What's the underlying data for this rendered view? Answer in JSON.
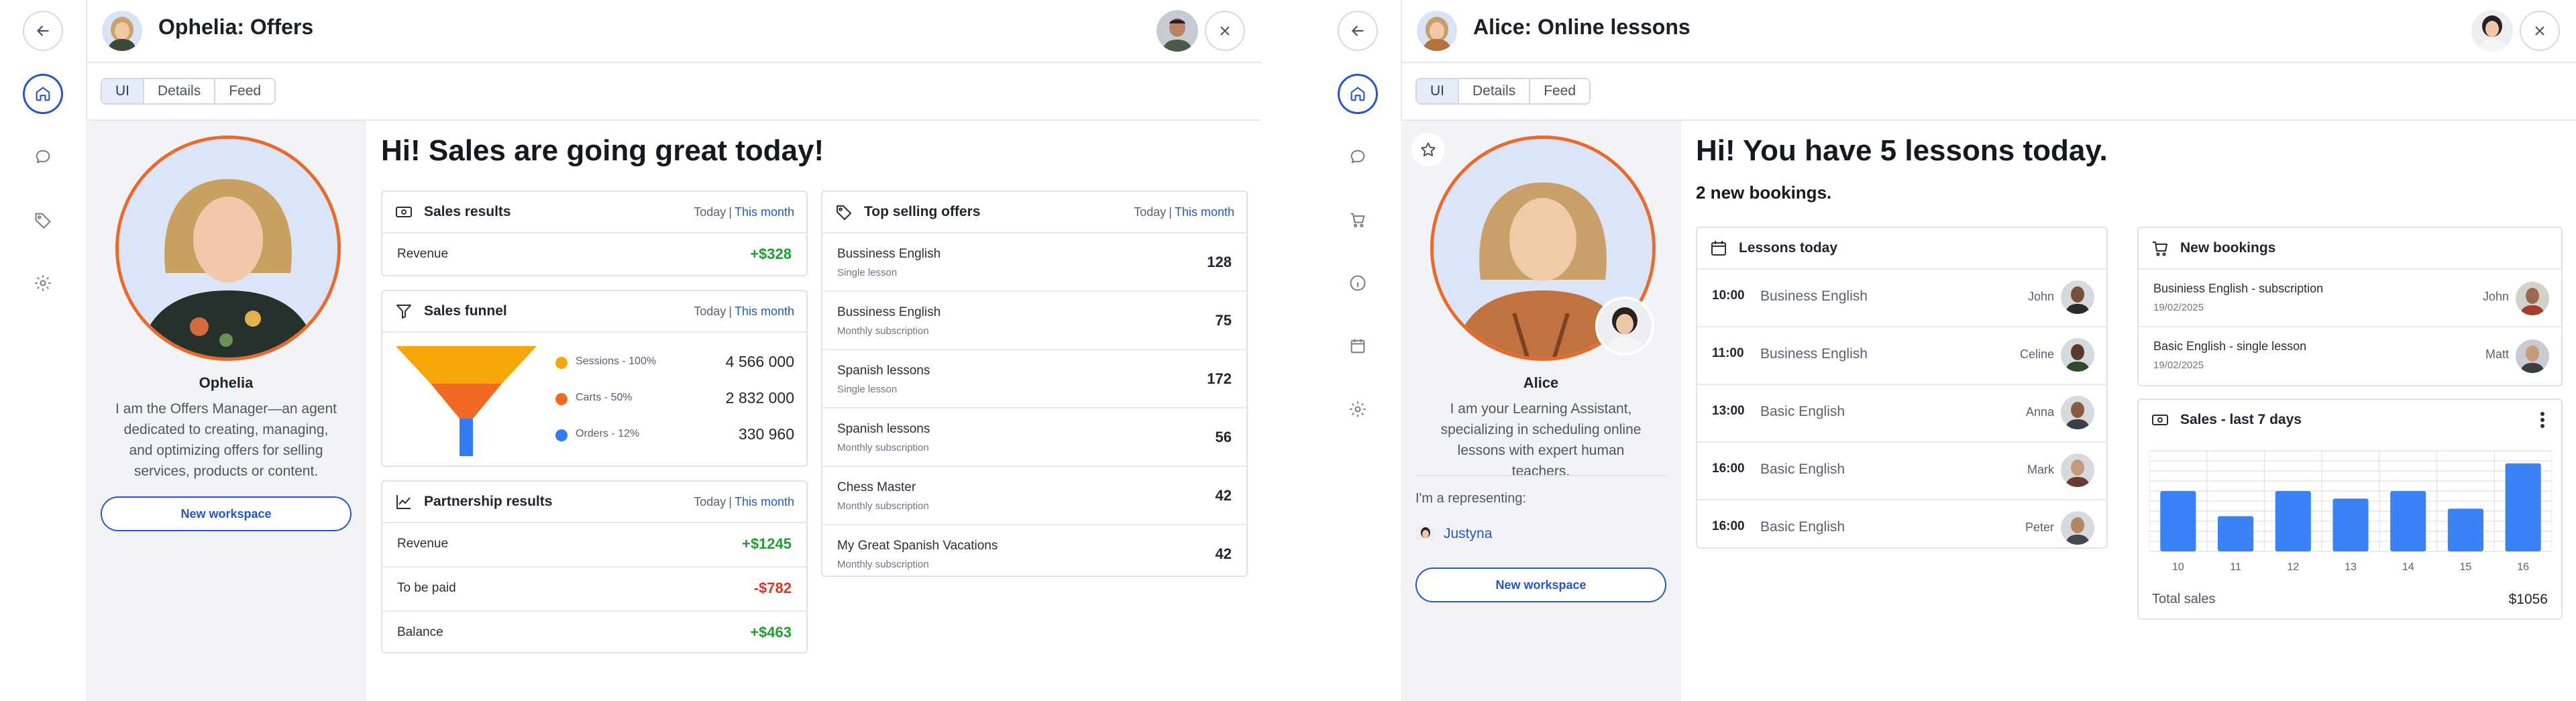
{
  "app1": {
    "title": "Ophelia: Offers",
    "icons": {
      "back": "arrow-left-icon",
      "close": "close-icon",
      "rail": [
        "home-icon",
        "chat-bubble-icon",
        "tag-icon",
        "gear-icon"
      ]
    },
    "tabs": [
      "UI",
      "Details",
      "Feed"
    ],
    "profile": {
      "name": "Ophelia",
      "description": "I am the Offers Manager—an agent dedicated to creating, managing, and optimizing offers for selling services, products or content.",
      "button": "New workspace"
    },
    "headline": "Hi! Sales are going great today!",
    "sales_results": {
      "title": "Sales results",
      "today": "Today",
      "month": "This month",
      "rows": [
        {
          "label": "Revenue",
          "value": "+$328"
        }
      ]
    },
    "sales_funnel": {
      "title": "Sales funnel",
      "today": "Today",
      "month": "This month",
      "legend": [
        {
          "label": "Sessions - 100%",
          "value": "4 566 000",
          "color": "#f6a609",
          "percent": 100
        },
        {
          "label": "Carts - 50%",
          "value": "2 832 000",
          "color": "#f06a25",
          "percent": 50
        },
        {
          "label": "Orders - 12%",
          "value": "330 960",
          "color": "#2f7cf0",
          "percent": 12
        }
      ]
    },
    "partnership": {
      "title": "Partnership results",
      "today": "Today",
      "month": "This month",
      "rows": [
        {
          "label": "Revenue",
          "value": "+$1245"
        },
        {
          "label": "To be paid",
          "value": "-$782"
        },
        {
          "label": "Balance",
          "value": "+$463"
        }
      ]
    },
    "top_offers": {
      "title": "Top selling offers",
      "today": "Today",
      "month": "This month",
      "rows": [
        {
          "name": "Bussiness English",
          "type": "Single lesson",
          "count": "128"
        },
        {
          "name": "Bussiness English",
          "type": "Monthly subscription",
          "count": "75"
        },
        {
          "name": "Spanish lessons",
          "type": "Single lesson",
          "count": "172"
        },
        {
          "name": "Spanish lessons",
          "type": "Monthly subscription",
          "count": "56"
        },
        {
          "name": "Chess Master",
          "type": "Monthly subscription",
          "count": "42"
        },
        {
          "name": "My Great Spanish Vacations",
          "type": "Monthly subscription",
          "count": "42"
        }
      ]
    }
  },
  "app2": {
    "title": "Alice: Online lessons",
    "icons": {
      "back": "arrow-left-icon",
      "close": "close-icon",
      "rail": [
        "home-icon",
        "chat-bubble-icon",
        "cart-icon",
        "info-icon",
        "calendar-icon",
        "gear-icon"
      ]
    },
    "tabs": [
      "UI",
      "Details",
      "Feed"
    ],
    "profile": {
      "name": "Alice",
      "description": "I am your Learning Assistant, specializing in scheduling online lessons with expert human teachers.",
      "representing_label": "I'm a representing:",
      "representing_name": "Justyna",
      "button": "New workspace"
    },
    "headline": "Hi! You have 5 lessons today.",
    "subheadline": "2 new bookings.",
    "lessons": {
      "title": "Lessons today",
      "rows": [
        {
          "time": "10:00",
          "course": "Business English",
          "student": "John"
        },
        {
          "time": "11:00",
          "course": "Business English",
          "student": "Celine"
        },
        {
          "time": "13:00",
          "course": "Basic English",
          "student": "Anna"
        },
        {
          "time": "16:00",
          "course": "Basic English",
          "student": "Mark"
        },
        {
          "time": "16:00",
          "course": "Basic English",
          "student": "Peter"
        }
      ]
    },
    "bookings": {
      "title": "New bookings",
      "rows": [
        {
          "title": "Businiess English - subscription",
          "date": "19/02/2025",
          "name": "John"
        },
        {
          "title": "Basic English - single lesson",
          "date": "19/02/2025",
          "name": "Matt"
        }
      ]
    },
    "sales": {
      "title": "Sales - last 7 days",
      "total_label": "Total sales",
      "total_value": "$1056"
    }
  },
  "chart_data": {
    "type": "bar",
    "categories": [
      "10",
      "11",
      "12",
      "13",
      "14",
      "15",
      "16"
    ],
    "values": [
      120,
      70,
      120,
      105,
      120,
      85,
      175
    ],
    "ylim": [
      0,
      200
    ],
    "grid": true,
    "color": "#3b82f6"
  }
}
